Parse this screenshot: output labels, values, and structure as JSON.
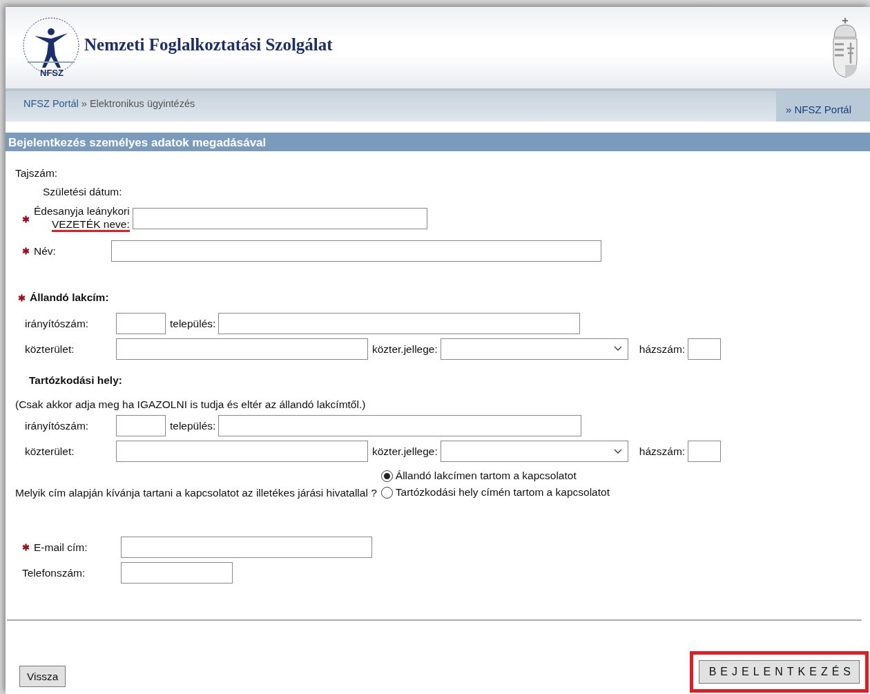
{
  "header": {
    "title": "Nemzeti Foglalkoztatási Szolgálat",
    "logo_text": "NFSZ"
  },
  "breadcrumb": {
    "items": [
      {
        "label": "NFSZ Portál",
        "kind": "link"
      },
      {
        "label": "Elektronikus ügyintézés",
        "kind": "current"
      }
    ],
    "separator": "»",
    "right_link": "» NFSZ Portál"
  },
  "section_title": "Bejelentkezés személyes adatok megadásával",
  "tajszam": {
    "label": "Tajszám:"
  },
  "birth_date": {
    "label": "Születési dátum:"
  },
  "mother_name": {
    "required": true,
    "label_lines": [
      {
        "text": "Édesanyja leánykori",
        "underlined": false
      },
      {
        "text": "VEZETÉK neve:",
        "underlined": true
      }
    ]
  },
  "name": {
    "required": true,
    "label": "Név:"
  },
  "addresses": [
    {
      "title": "Állandó lakcím:",
      "required": true,
      "zip_label": "irányítószám:",
      "city_label": "település:",
      "street_label": "közterület:",
      "street_type_label": "közter.jellege:",
      "house_label": "házszám:"
    },
    {
      "title": "Tartózkodási hely:",
      "required": false,
      "note": "(Csak akkor adja meg ha IGAZOLNI is tudja és eltér az állandó lakcímtől.)",
      "zip_label": "irányítószám:",
      "city_label": "település:",
      "street_label": "közterület:",
      "street_type_label": "közter.jellege:",
      "house_label": "házszám:"
    }
  ],
  "contact": {
    "question": "Melyik cím alapján kívánja tartani a kapcsolatot az illetékes járási hivatallal ?",
    "options": [
      {
        "label": "Állandó lakcímen tartom a kapcsolatot",
        "selected": true
      },
      {
        "label": "Tartózkodási hely címén tartom a kapcsolatot",
        "selected": false
      }
    ]
  },
  "email": {
    "required": true,
    "label": "E-mail cím:"
  },
  "phone": {
    "required": false,
    "label": "Telefonszám:"
  },
  "buttons": {
    "back": "Vissza",
    "submit": {
      "label": "BEJELENTKEZÉS",
      "highlighted": true
    }
  }
}
